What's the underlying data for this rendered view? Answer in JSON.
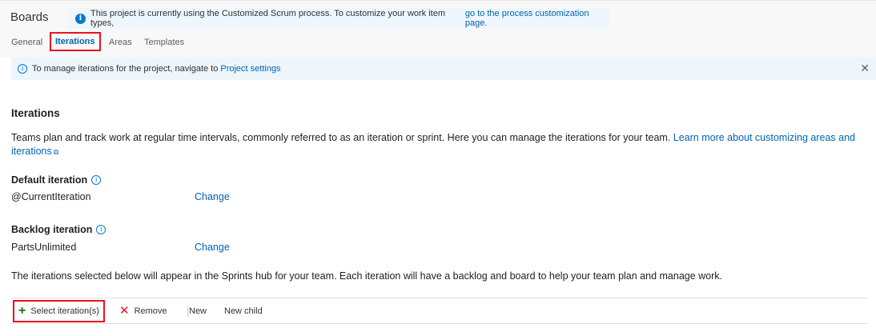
{
  "header": {
    "title": "Boards",
    "banner_text": "This project is currently using the Customized Scrum process. To customize your work item types, ",
    "banner_link": "go to the process customization page."
  },
  "tabs": [
    {
      "label": "General"
    },
    {
      "label": "Iterations"
    },
    {
      "label": "Areas"
    },
    {
      "label": "Templates"
    }
  ],
  "manage_bar": {
    "text": "To manage iterations for the project, navigate to ",
    "link": "Project settings"
  },
  "section": {
    "title": "Iterations",
    "description": "Teams plan and track work at regular time intervals, commonly referred to as an iteration or sprint. Here you can manage the iterations for your team. ",
    "learn_more_link": "Learn more about customizing areas and iterations"
  },
  "default_iteration": {
    "label": "Default iteration",
    "value": "@CurrentIteration",
    "change": "Change"
  },
  "backlog_iteration": {
    "label": "Backlog iteration",
    "value": "PartsUnlimited",
    "change": "Change"
  },
  "note": "The iterations selected below will appear in the Sprints hub for your team. Each iteration will have a backlog and board to help your team plan and manage work.",
  "toolbar": {
    "select_label": "Select iteration(s)",
    "remove_label": "Remove",
    "new_label": "New",
    "new_child_label": "New child"
  },
  "colors": {
    "accent": "#0078d4",
    "link": "#0063b1",
    "highlight_box": "#e81123",
    "add_icon": "#107c10"
  },
  "icons": [
    "info-icon",
    "close-icon",
    "external-link-icon",
    "add-icon",
    "remove-icon"
  ]
}
